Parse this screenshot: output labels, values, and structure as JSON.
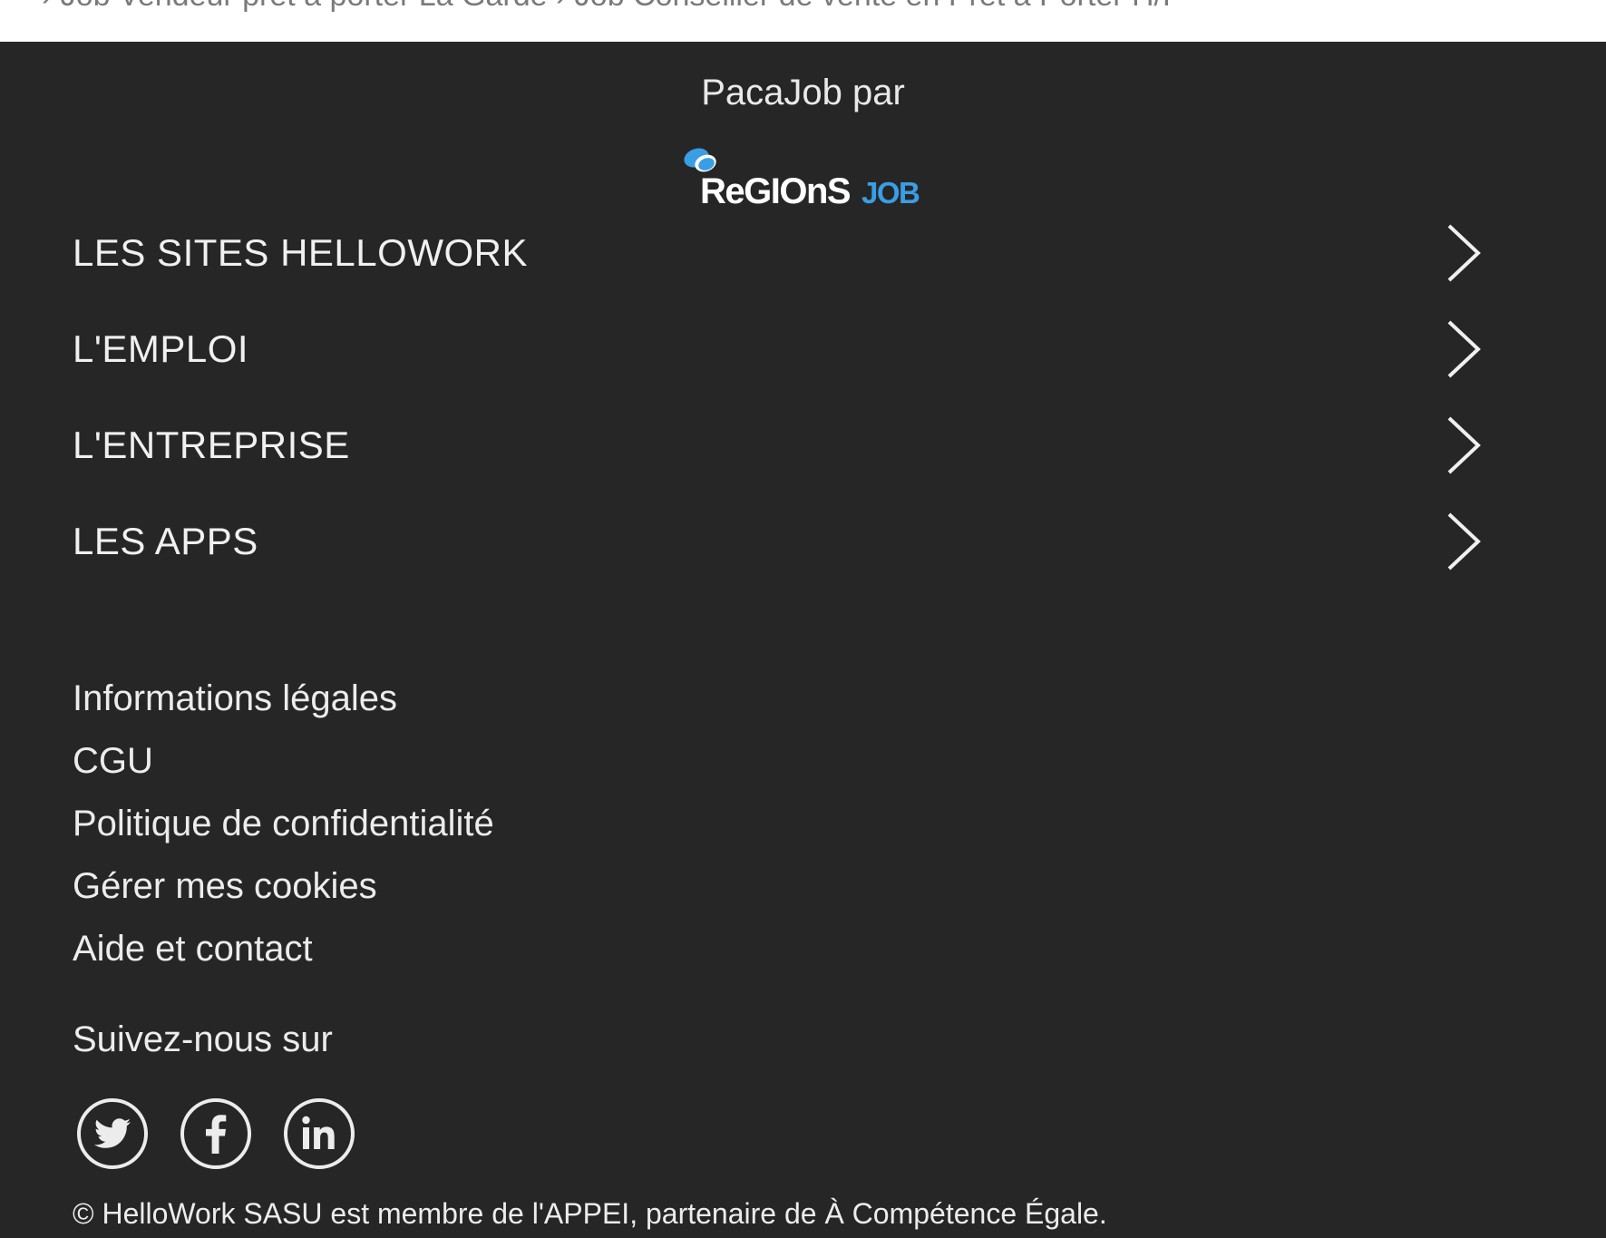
{
  "top_strip": {
    "related_link": "› Job Vendeur prêt à porter La Garde › Job Conseiller de vente en Prêt à Porter H/F"
  },
  "footer": {
    "brand_line": "PacaJob par",
    "logo": {
      "name": "regionsjob-logo",
      "text_main": "ReGIOnS",
      "text_accent": "JOB",
      "accent_color": "#3a9ee4"
    },
    "nav": [
      {
        "label": "LES SITES HELLOWORK"
      },
      {
        "label": "L'EMPLOI"
      },
      {
        "label": "L'ENTREPRISE"
      },
      {
        "label": "LES APPS"
      }
    ],
    "legal_links": [
      "Informations légales",
      "CGU",
      "Politique de confidentialité",
      "Gérer mes cookies",
      "Aide et contact"
    ],
    "follow_label": "Suivez-nous sur",
    "socials": [
      {
        "name": "twitter-icon"
      },
      {
        "name": "facebook-icon"
      },
      {
        "name": "linkedin-icon"
      }
    ],
    "copyright": "© HelloWork SASU est membre de l'APPEI, partenaire de À Compétence Égale."
  },
  "colors": {
    "footer_bg": "#262626",
    "text": "#ececec",
    "accent": "#3a9ee4"
  }
}
